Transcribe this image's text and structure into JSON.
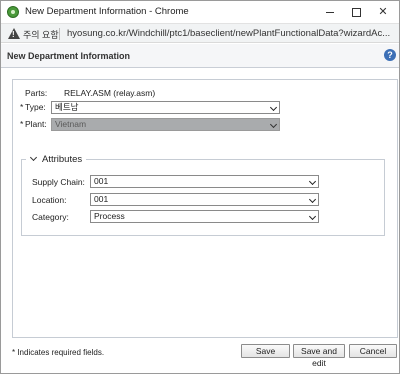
{
  "window": {
    "title": "New Department Information - Chrome",
    "controls": {
      "minimize": "",
      "maximize": "",
      "close": "✕"
    }
  },
  "address_bar": {
    "security_label": "주의 요함",
    "url": "hyosung.co.kr/Windchill/ptc1/baseclient/newPlantFunctionalData?wizardAc..."
  },
  "dialog": {
    "title": "New Department Information",
    "help_icon": "?"
  },
  "form": {
    "parts_label": "Parts:",
    "parts_value": "RELAY.ASM (relay.asm)",
    "type_label": "Type:",
    "type_value": "베트남",
    "plant_label": "Plant:",
    "plant_value": "Vietnam",
    "required_marker": "*"
  },
  "attributes": {
    "title": "Attributes",
    "supply_chain_label": "Supply Chain:",
    "supply_chain_value": "001",
    "location_label": "Location:",
    "location_value": "001",
    "category_label": "Category:",
    "category_value": "Process"
  },
  "footer": {
    "required_note": "* Indicates required fields.",
    "save_label": "Save",
    "save_and_edit_label": "Save and edit",
    "cancel_label": "Cancel"
  }
}
